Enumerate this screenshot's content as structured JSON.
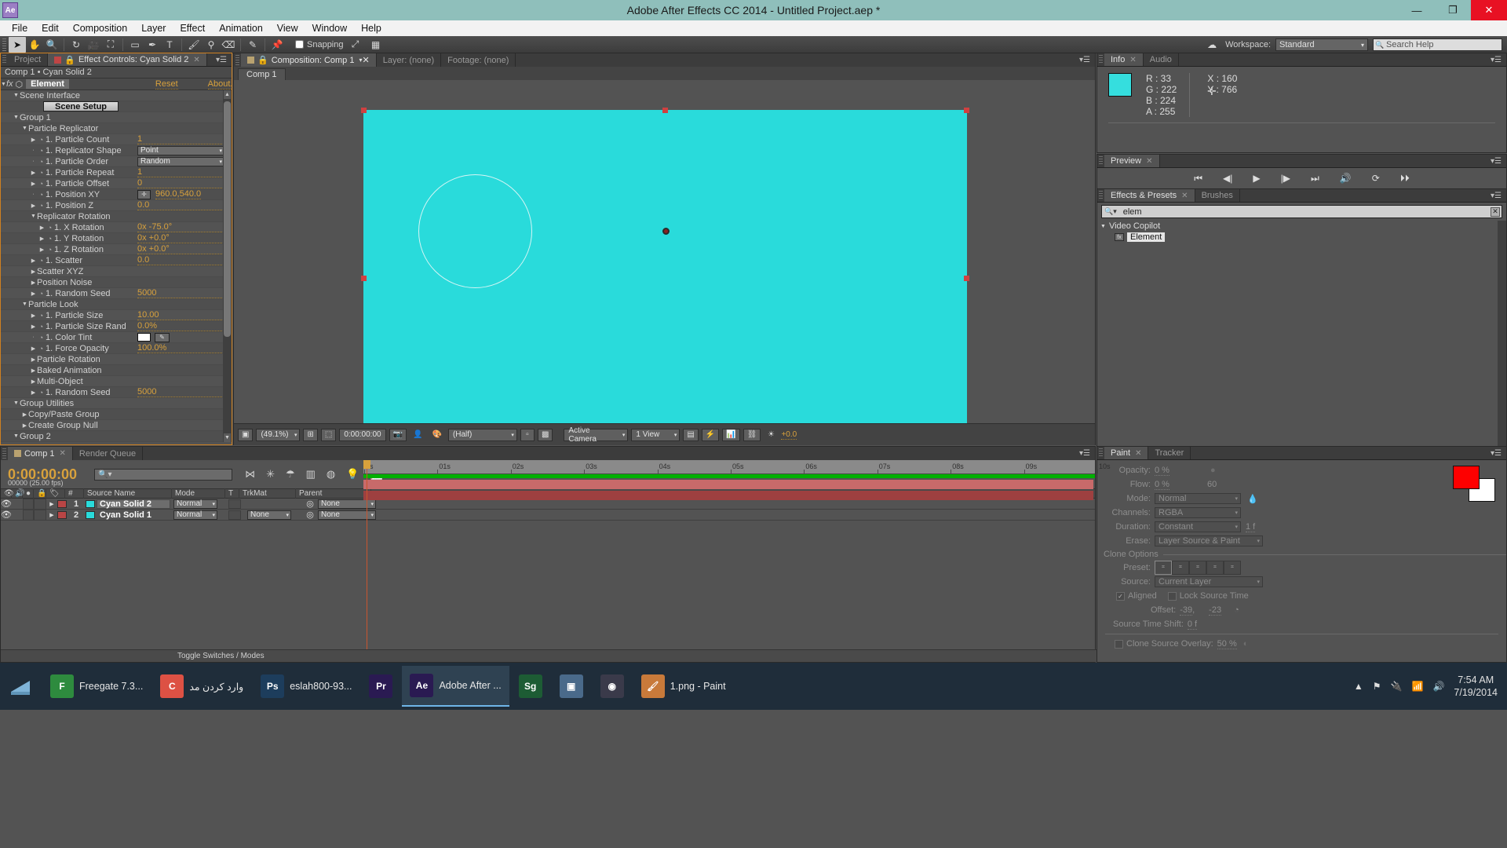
{
  "window": {
    "app_icon": "Ae",
    "title": "Adobe After Effects CC 2014 - Untitled Project.aep *",
    "minimize": "—",
    "maximize": "❐",
    "close": "✕"
  },
  "menubar": [
    "File",
    "Edit",
    "Composition",
    "Layer",
    "Effect",
    "Animation",
    "View",
    "Window",
    "Help"
  ],
  "toolbar": {
    "snapping_label": "Snapping",
    "workspace_label": "Workspace:",
    "workspace_value": "Standard",
    "search_placeholder": "Search Help"
  },
  "effect_controls": {
    "tab_project": "Project",
    "tab_active": "Effect Controls: Cyan Solid 2",
    "subtitle": "Comp 1 • Cyan Solid 2",
    "effect_name": "Element",
    "reset": "Reset",
    "about": "About...",
    "scene_setup": "Scene Setup",
    "rows": [
      {
        "indent": 1,
        "tw": "▼",
        "name": "Scene Interface",
        "type": "group"
      },
      {
        "indent": 2,
        "name": "",
        "type": "button"
      },
      {
        "indent": 1,
        "tw": "▼",
        "name": "Group 1",
        "type": "group"
      },
      {
        "indent": 2,
        "tw": "▼",
        "name": "Particle Replicator",
        "type": "group"
      },
      {
        "indent": 3,
        "tw": "▶",
        "stop": "◔",
        "name": "1. Particle Count",
        "value": "1",
        "type": "val"
      },
      {
        "indent": 3,
        "tw": "·",
        "stop": "◔",
        "name": "1. Replicator Shape",
        "value": "Point",
        "type": "dd"
      },
      {
        "indent": 3,
        "tw": "·",
        "stop": "◔",
        "name": "1. Particle Order",
        "value": "Random",
        "type": "dd"
      },
      {
        "indent": 3,
        "tw": "▶",
        "stop": "◔",
        "name": "1. Particle Repeat",
        "value": "1",
        "type": "val"
      },
      {
        "indent": 3,
        "tw": "▶",
        "stop": "◔",
        "name": "1. Particle Offset",
        "value": "0",
        "type": "val"
      },
      {
        "indent": 3,
        "tw": "·",
        "stop": "◔",
        "name": "1. Position XY",
        "value": "960.0,540.0",
        "type": "pos"
      },
      {
        "indent": 3,
        "tw": "▶",
        "stop": "◔",
        "name": "1. Position Z",
        "value": "0.0",
        "type": "val"
      },
      {
        "indent": 3,
        "tw": "▼",
        "name": "Replicator Rotation",
        "type": "group"
      },
      {
        "indent": 4,
        "tw": "▶",
        "stop": "◔",
        "name": "1. X Rotation",
        "value": "0x -75.0°",
        "type": "val"
      },
      {
        "indent": 4,
        "tw": "▶",
        "stop": "◔",
        "name": "1. Y Rotation",
        "value": "0x +0.0°",
        "type": "val"
      },
      {
        "indent": 4,
        "tw": "▶",
        "stop": "◔",
        "name": "1. Z Rotation",
        "value": "0x +0.0°",
        "type": "val"
      },
      {
        "indent": 3,
        "tw": "▶",
        "stop": "◔",
        "name": "1. Scatter",
        "value": "0.0",
        "type": "val"
      },
      {
        "indent": 3,
        "tw": "▶",
        "name": "Scatter XYZ",
        "type": "group"
      },
      {
        "indent": 3,
        "tw": "▶",
        "name": "Position Noise",
        "type": "group"
      },
      {
        "indent": 3,
        "tw": "▶",
        "stop": "◔",
        "name": "1. Random Seed",
        "value": "5000",
        "type": "val"
      },
      {
        "indent": 2,
        "tw": "▼",
        "name": "Particle Look",
        "type": "group"
      },
      {
        "indent": 3,
        "tw": "▶",
        "stop": "◔",
        "name": "1. Particle Size",
        "value": "10.00",
        "type": "val"
      },
      {
        "indent": 3,
        "tw": "▶",
        "stop": "◔",
        "name": "1. Particle Size Rand",
        "value": "0.0%",
        "type": "val"
      },
      {
        "indent": 3,
        "tw": "·",
        "stop": "◔",
        "name": "1. Color Tint",
        "value": "#ffffff",
        "type": "color"
      },
      {
        "indent": 3,
        "tw": "▶",
        "stop": "◔",
        "name": "1. Force Opacity",
        "value": "100.0%",
        "type": "val"
      },
      {
        "indent": 3,
        "tw": "▶",
        "name": "Particle Rotation",
        "type": "group"
      },
      {
        "indent": 3,
        "tw": "▶",
        "name": "Baked Animation",
        "type": "group"
      },
      {
        "indent": 3,
        "tw": "▶",
        "name": "Multi-Object",
        "type": "group"
      },
      {
        "indent": 3,
        "tw": "▶",
        "stop": "◔",
        "name": "1. Random Seed",
        "value": "5000",
        "type": "val"
      },
      {
        "indent": 1,
        "tw": "▼",
        "name": "Group Utilities",
        "type": "group"
      },
      {
        "indent": 2,
        "tw": "▶",
        "name": "Copy/Paste Group",
        "type": "group"
      },
      {
        "indent": 2,
        "tw": "▶",
        "name": "Create Group Null",
        "type": "group"
      },
      {
        "indent": 1,
        "tw": "▼",
        "name": "Group 2",
        "type": "group"
      }
    ]
  },
  "composition": {
    "tab_comp": "Composition: Comp 1",
    "tab_layer": "Layer: (none)",
    "tab_footage": "Footage: (none)",
    "comp_tag": "Comp 1",
    "toolbar": {
      "zoom": "(49.1%)",
      "time": "0:00:00:00",
      "resolution": "(Half)",
      "camera": "Active Camera",
      "views": "1 View",
      "exposure": "+0.0"
    }
  },
  "info": {
    "tab": "Info",
    "tab2": "Audio",
    "R": "R : 33",
    "G": "G : 222",
    "B": "B : 224",
    "A": "A : 255",
    "X": "X : 160",
    "Y": "Y : 766",
    "swatch": "#22dee0"
  },
  "preview": {
    "tab": "Preview"
  },
  "effects_presets": {
    "tab": "Effects & Presets",
    "tab2": "Brushes",
    "search_value": "elem",
    "category": "Video Copilot",
    "item": "Element"
  },
  "paint": {
    "tab": "Paint",
    "tab2": "Tracker",
    "opacity_label": "Opacity:",
    "opacity_value": "0 %",
    "flow_label": "Flow:",
    "flow_value": "0 %",
    "brush_size": "60",
    "mode_label": "Mode:",
    "mode_value": "Normal",
    "channels_label": "Channels:",
    "channels_value": "RGBA",
    "duration_label": "Duration:",
    "duration_value": "Constant",
    "duration_frames": "1 f",
    "erase_label": "Erase:",
    "erase_value": "Layer Source & Paint",
    "clone_options": "Clone Options",
    "preset_label": "Preset:",
    "source_label": "Source:",
    "source_value": "Current Layer",
    "aligned": "Aligned",
    "lock_source_time": "Lock Source Time",
    "offset_label": "Offset:",
    "offset_x": "-39",
    "offset_y": "-23",
    "source_time_shift_label": "Source Time Shift:",
    "source_time_shift": "0  f",
    "clone_overlay_label": "Clone Source Overlay:",
    "clone_overlay_value": "50 %",
    "fg_color": "#fe0000",
    "bg_color": "#ffffff"
  },
  "timeline": {
    "tab": "Comp 1",
    "tab2": "Render Queue",
    "time": "0:00:00:00",
    "frames": "00000 (25.00 fps)",
    "columns": [
      "#",
      "Source Name",
      "Mode",
      "T",
      "TrkMat",
      "Parent"
    ],
    "layers": [
      {
        "index": "1",
        "name": "Cyan Solid 2",
        "mode": "Normal",
        "trkmat": "",
        "parent": "None",
        "color": "#29dbdb",
        "label": "#b94545",
        "selected": true
      },
      {
        "index": "2",
        "name": "Cyan Solid 1",
        "mode": "Normal",
        "trkmat": "None",
        "parent": "None",
        "color": "#29dbdb",
        "label": "#b94545",
        "selected": false
      }
    ],
    "ruler_ticks": [
      "0s",
      "01s",
      "02s",
      "03s",
      "04s",
      "05s",
      "06s",
      "07s",
      "08s",
      "09s",
      "10s"
    ],
    "toggle_switches": "Toggle Switches / Modes"
  },
  "taskbar": {
    "items": [
      {
        "label": "Freegate 7.3...",
        "icon": "F",
        "color": "#2e8b3e",
        "active": false
      },
      {
        "label": "وارد کردن مد",
        "icon": "C",
        "color": "#dd5144",
        "active": false
      },
      {
        "label": "eslah800-93...",
        "icon": "Ps",
        "color": "#1d3d5c",
        "active": false
      },
      {
        "label": "",
        "icon": "Pr",
        "color": "#2a1a52",
        "active": false
      },
      {
        "label": "Adobe After ...",
        "icon": "Ae",
        "color": "#2a1a52",
        "active": true
      },
      {
        "label": "",
        "icon": "Sg",
        "color": "#1d5c34",
        "active": false
      },
      {
        "label": "",
        "icon": "▣",
        "color": "#4a6a8a",
        "active": false
      },
      {
        "label": "",
        "icon": "◉",
        "color": "#3a3a4a",
        "active": false
      },
      {
        "label": "1.png - Paint",
        "icon": "🖌",
        "color": "#c87a3a",
        "active": false
      }
    ],
    "clock_time": "7:54 AM",
    "clock_date": "7/19/2014"
  }
}
